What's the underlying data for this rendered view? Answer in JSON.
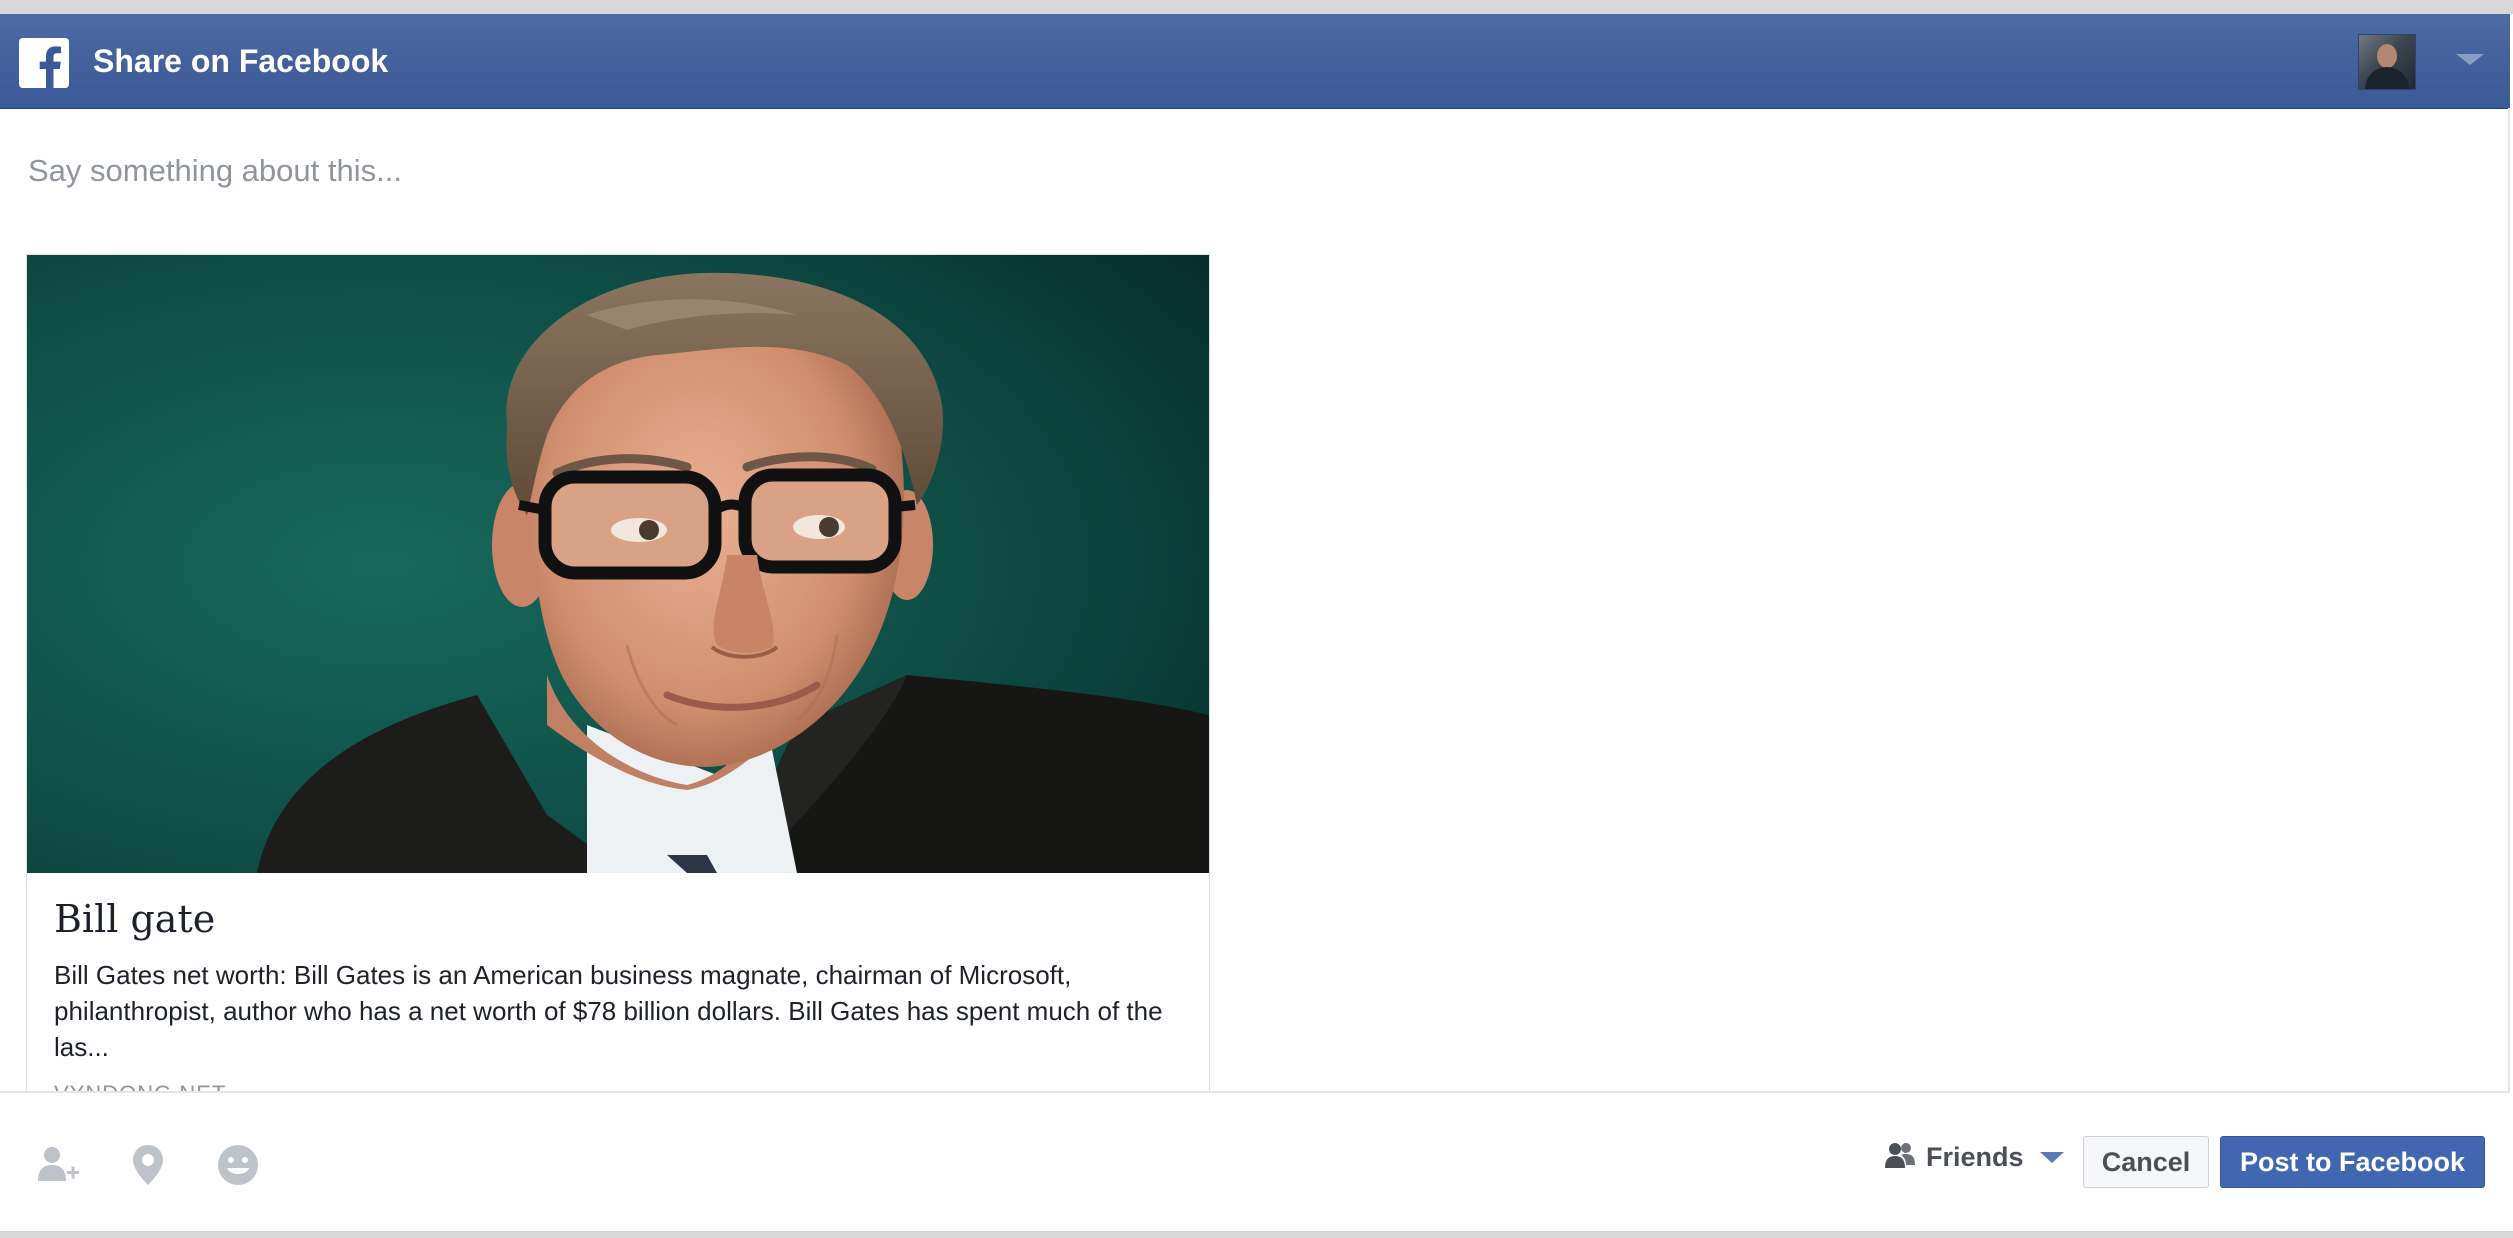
{
  "header": {
    "title": "Share on Facebook",
    "logo_icon": "facebook-logo-icon",
    "account_icon": "user-avatar",
    "menu_icon": "caret-down-icon",
    "bar_color": "#3b5998"
  },
  "composer": {
    "placeholder": "Say something about this...",
    "value": ""
  },
  "link_preview": {
    "image_icon": "portrait-photo",
    "title": "Bill gate",
    "description": "Bill Gates net worth: Bill Gates is an American business magnate, chairman of Microsoft, philanthropist, author who has a net worth of $78 billion dollars. Bill Gates has spent much of the las...",
    "domain": "VYNDONG.NET"
  },
  "footer": {
    "tools": [
      {
        "icon": "tag-friends-icon"
      },
      {
        "icon": "location-pin-icon"
      },
      {
        "icon": "feeling-emoji-icon"
      }
    ],
    "audience": {
      "icon": "friends-icon",
      "label": "Friends",
      "caret": "caret-down-icon"
    },
    "cancel_label": "Cancel",
    "post_label": "Post to Facebook",
    "post_color": "#4267b2"
  }
}
